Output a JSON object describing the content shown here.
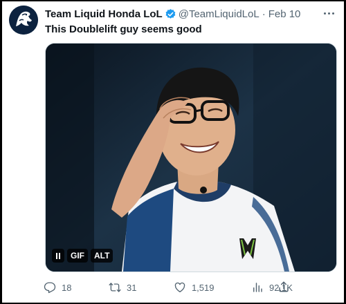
{
  "tweet": {
    "author": {
      "display_name": "Team Liquid Honda LoL",
      "handle": "@TeamLiquidLoL",
      "verified": true,
      "avatar": "team-liquid-horse-logo"
    },
    "separator": "·",
    "timestamp": "Feb 10",
    "text": "This Doublelift guy seems good",
    "media": {
      "type": "gif",
      "badges": {
        "pause": "pause-icon",
        "gif": "GIF",
        "alt": "ALT"
      }
    },
    "actions": {
      "replies": "18",
      "reposts": "31",
      "likes": "1,519",
      "views": "92.1K"
    },
    "icons": {
      "more": "more-dots-icon",
      "reply": "reply-icon",
      "repost": "repost-icon",
      "like": "heart-icon",
      "views": "views-chart-icon",
      "share": "share-icon"
    },
    "colors": {
      "text_primary": "#0f1419",
      "text_secondary": "#536471",
      "verified_blue": "#1d9bf0",
      "avatar_bg": "#0c223f"
    }
  }
}
